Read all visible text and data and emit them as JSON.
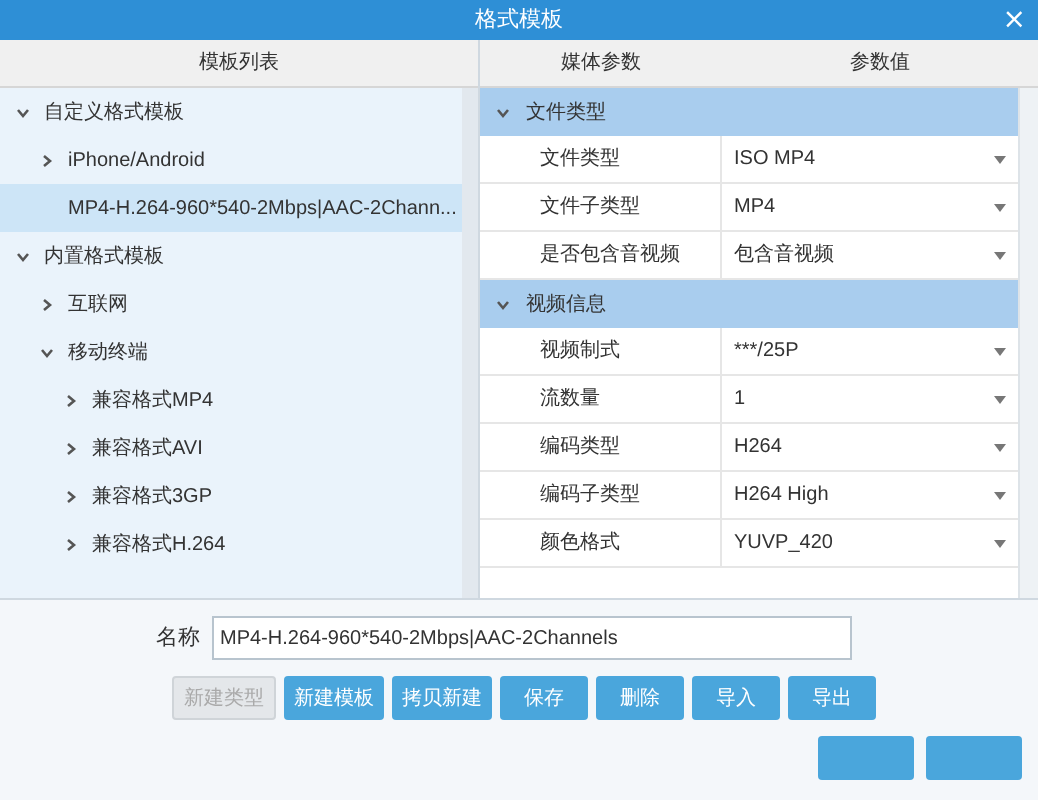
{
  "window": {
    "title": "格式模板",
    "close": "×"
  },
  "template_list": {
    "header": "模板列表",
    "items": [
      {
        "label": "自定义格式模板",
        "expanded": true,
        "selected": false,
        "children": [
          {
            "label": "iPhone/Android",
            "expanded": false,
            "selected": false
          },
          {
            "label": "MP4-H.264-960*540-2Mbps|AAC-2Chann...",
            "selected": true
          }
        ]
      },
      {
        "label": "内置格式模板",
        "expanded": true,
        "selected": false,
        "children": [
          {
            "label": "互联网",
            "expanded": false,
            "selected": false
          },
          {
            "label": "移动终端",
            "expanded": true,
            "selected": false,
            "children": [
              {
                "label": "兼容格式MP4",
                "expanded": false,
                "selected": false
              },
              {
                "label": "兼容格式AVI",
                "expanded": false,
                "selected": false
              },
              {
                "label": "兼容格式3GP",
                "expanded": false,
                "selected": false
              },
              {
                "label": "兼容格式H.264",
                "expanded": false,
                "selected": false
              }
            ]
          }
        ]
      }
    ]
  },
  "media_params": {
    "columns": [
      "媒体参数",
      "参数值"
    ],
    "groups": [
      {
        "label": "文件类型",
        "expanded": true,
        "rows": [
          {
            "name": "文件类型",
            "value": "ISO MP4"
          },
          {
            "name": "文件子类型",
            "value": "MP4"
          },
          {
            "name": "是否包含音视频",
            "value": "包含音视频"
          }
        ]
      },
      {
        "label": "视频信息",
        "expanded": true,
        "rows": [
          {
            "name": "视频制式",
            "value": "***/25P"
          },
          {
            "name": "流数量",
            "value": "1"
          },
          {
            "name": "编码类型",
            "value": "H264"
          },
          {
            "name": "编码子类型",
            "value": "H264 High"
          },
          {
            "name": "颜色格式",
            "value": "YUVP_420"
          }
        ]
      }
    ]
  },
  "name_field": {
    "label": "名称",
    "value": "MP4-H.264-960*540-2Mbps|AAC-2Channels"
  },
  "buttons": [
    {
      "label": "新建类型",
      "disabled": true
    },
    {
      "label": "新建模板",
      "disabled": false
    },
    {
      "label": "拷贝新建",
      "disabled": false
    },
    {
      "label": "保存",
      "disabled": false
    },
    {
      "label": "删除",
      "disabled": false
    },
    {
      "label": "导入",
      "disabled": false
    },
    {
      "label": "导出",
      "disabled": false
    }
  ]
}
